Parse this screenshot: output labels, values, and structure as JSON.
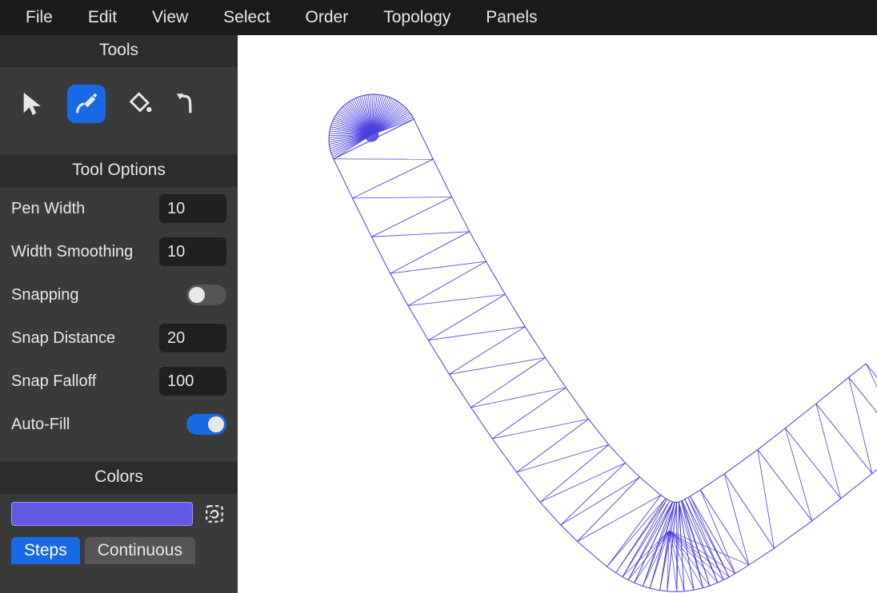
{
  "menu": {
    "file": "File",
    "edit": "Edit",
    "view": "View",
    "select": "Select",
    "order": "Order",
    "topology": "Topology",
    "panels": "Panels"
  },
  "sidebar": {
    "tools_header": "Tools",
    "tool_options_header": "Tool Options",
    "colors_header": "Colors",
    "active_tool": "pen",
    "options": {
      "pen_width": {
        "label": "Pen Width",
        "value": "10"
      },
      "width_smoothing": {
        "label": "Width Smoothing",
        "value": "10"
      },
      "snapping": {
        "label": "Snapping",
        "enabled": false
      },
      "snap_distance": {
        "label": "Snap Distance",
        "value": "20"
      },
      "snap_falloff": {
        "label": "Snap Falloff",
        "value": "100"
      },
      "auto_fill": {
        "label": "Auto-Fill",
        "enabled": true
      }
    },
    "colors": {
      "current": "#6159e6",
      "tabs": {
        "steps": "Steps",
        "continuous": "Continuous"
      },
      "active_tab": "steps"
    }
  },
  "canvas": {
    "stroke_color": "#4a3fe0"
  }
}
